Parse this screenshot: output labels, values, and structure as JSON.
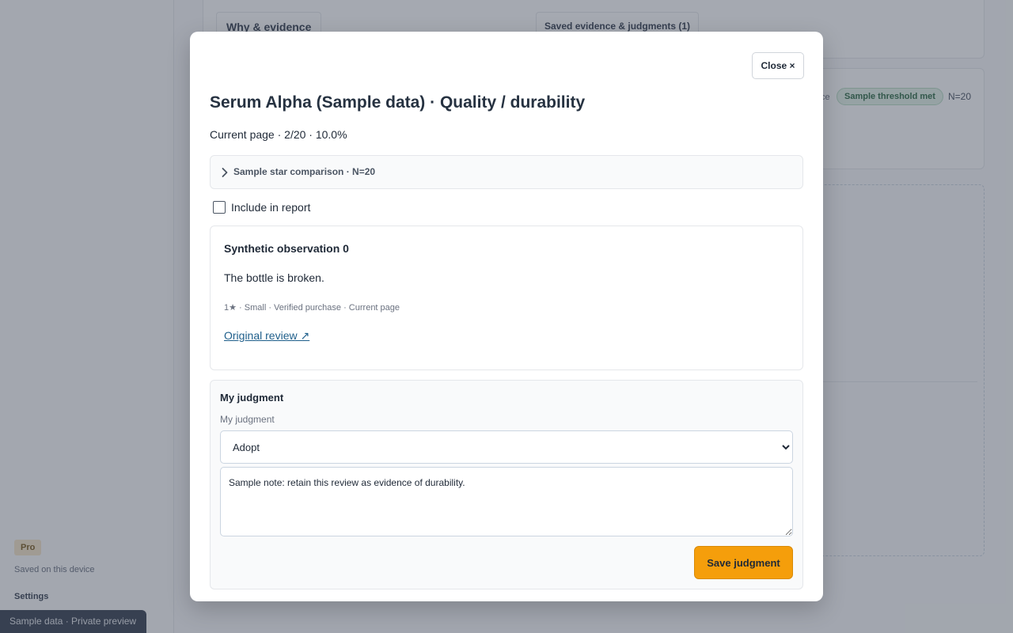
{
  "sidebar": {
    "pro_badge": "Pro",
    "saved_text": "Saved on this device",
    "settings": "Settings",
    "banner": "Sample data · Private preview"
  },
  "background": {
    "tab_why": "Why & evidence",
    "tab_saved": "Saved evidence & judgments (1)",
    "mid_fragment": "ce",
    "threshold": "Sample threshold met",
    "n": "N=20"
  },
  "modal": {
    "close_label": "Close ×",
    "title": "Serum Alpha (Sample data) · Quality / durability",
    "page_info": "Current page · 2/20 · 10.0%",
    "star_comparison": "Sample star comparison · N=20",
    "include_label": "Include in report",
    "observation": {
      "title": "Synthetic observation 0",
      "text": "The bottle is broken.",
      "meta": "1★ · Small · Verified purchase · Current page",
      "link": "Original review ↗"
    },
    "judgment": {
      "title": "My judgment",
      "label": "My judgment",
      "selected": "Adopt",
      "note": "Sample note: retain this review as evidence of durability.",
      "save_label": "Save judgment"
    }
  }
}
